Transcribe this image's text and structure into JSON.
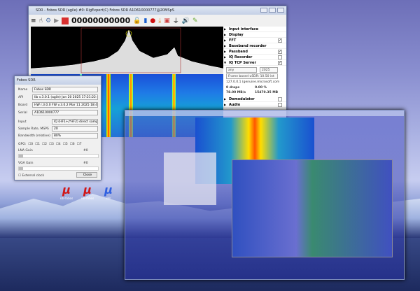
{
  "main_window": {
    "title": "SDR - Fobos SDR (agile) #0: RigExpert(C) Fobos SDR A1D610000777@20MSpS",
    "frequency": "00000000000",
    "toolbar_icons": [
      "menu-icon",
      "hand-icon",
      "gear-icon",
      "play-icon",
      "stop-icon",
      "lock-icon",
      "bars-icon",
      "record-icon",
      "download-icon",
      "screenshot-icon",
      "filter-icon",
      "speaker-icon",
      "pencil-icon"
    ],
    "panel": {
      "sections": [
        {
          "label": "Input interface"
        },
        {
          "label": "Display"
        },
        {
          "label": "FFT",
          "checked": true
        },
        {
          "label": "Baseband recorder"
        },
        {
          "label": "Passband",
          "checked": true
        },
        {
          "label": "IQ Recorder",
          "checked": false
        },
        {
          "label": "IQ TCP Server",
          "checked": true,
          "open": true
        }
      ],
      "server": {
        "host": "any",
        "port": "2025",
        "mode": "Frame based uSDR: 10.50 int",
        "client": "127.0.0.1 (genuine.microsoft.com",
        "drops": "0 drops",
        "drop_pct": "0.00 %",
        "rate": "78.00 MB/s",
        "total": "15470.35 MB"
      },
      "more": [
        {
          "label": "Demodulator",
          "checked": false
        },
        {
          "label": "Audio",
          "checked": false
        }
      ]
    }
  },
  "device_dialog": {
    "title": "Fobos SDR",
    "fields": [
      {
        "label": "Name",
        "value": "Fobos SDR"
      },
      {
        "label": "API",
        "value": "lib v.3.0.1 (agile) Jan 20 2025 17:21:22 drv lib"
      },
      {
        "label": "Board",
        "value": "HW r.3.0.0 FW v.3.0.2 Mar 11 2025 18:42:44"
      },
      {
        "label": "Serial",
        "value": "A1D610000777"
      }
    ],
    "selects": [
      {
        "label": "Input",
        "value": "IQ (HF1+j*HF2) direct samp"
      },
      {
        "label": "Sample Rate, MSPS",
        "value": "20"
      },
      {
        "label": "Bandwidth (relative)",
        "value": "80%"
      }
    ],
    "gpo_label": "GPO:",
    "gpo": [
      "0",
      "1",
      "2",
      "3",
      "4",
      "5",
      "6",
      "7"
    ],
    "lna_label": "LNA Gain",
    "lna_value": "#0",
    "vga_label": "VGA Gain",
    "vga_value": "#0",
    "external_clock": "External clock",
    "close": "Close"
  },
  "desktop_icons": [
    {
      "label": "sdr-fobos"
    },
    {
      "label": "sdr-fobos"
    },
    {
      "label": "sdr"
    }
  ]
}
